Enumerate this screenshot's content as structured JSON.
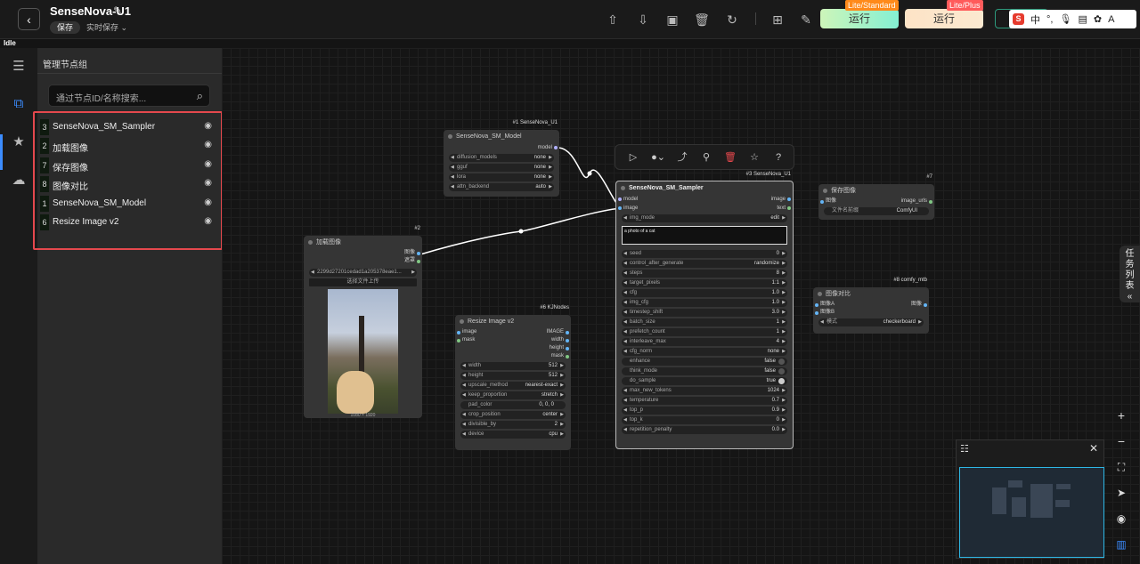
{
  "header": {
    "title": "SenseNova-U1",
    "save_label": "保存",
    "autosave_label": "实时保存",
    "run_lite_label": "运行",
    "run_lite_tag": "Lite/Standard",
    "run_plus_label": "运行",
    "run_plus_tag": "Lite/Plus",
    "ime_items": [
      "中",
      "A"
    ]
  },
  "status": "Idle",
  "panel": {
    "title": "管理节点组",
    "search_placeholder": "通过节点ID/名称搜索...",
    "nodes": [
      {
        "id": "3",
        "name": "SenseNova_SM_Sampler"
      },
      {
        "id": "2",
        "name": "加载图像"
      },
      {
        "id": "7",
        "name": "保存图像"
      },
      {
        "id": "8",
        "name": "图像对比"
      },
      {
        "id": "1",
        "name": "SenseNova_SM_Model"
      },
      {
        "id": "6",
        "name": "Resize Image v2"
      }
    ]
  },
  "canvas": {
    "model_node": {
      "badge": "#1 SenseNova_U1",
      "title": "SenseNova_SM_Model",
      "output": "model",
      "widgets": [
        {
          "k": "diffusion_models",
          "v": "none"
        },
        {
          "k": "gguf",
          "v": "none"
        },
        {
          "k": "lora",
          "v": "none"
        },
        {
          "k": "attn_backend",
          "v": "auto"
        }
      ]
    },
    "load_node": {
      "badge": "#2",
      "title": "加载图像",
      "out1": "图像",
      "out2": "遮罩",
      "file": "2299d27201cedad1a205378eae1...",
      "upload": "选择文件上传",
      "dims": "1080 × 1920"
    },
    "resize_node": {
      "badge": "#6 KJNodes",
      "title": "Resize Image v2",
      "in1": "image",
      "in2": "mask",
      "outs": [
        "IMAGE",
        "width",
        "height",
        "mask"
      ],
      "widgets": [
        {
          "k": "width",
          "v": "512"
        },
        {
          "k": "height",
          "v": "512"
        },
        {
          "k": "upscale_method",
          "v": "nearest-exact"
        },
        {
          "k": "keep_proportion",
          "v": "stretch"
        },
        {
          "k": "pad_color",
          "v": "0, 0, 0"
        },
        {
          "k": "crop_position",
          "v": "center"
        },
        {
          "k": "divisible_by",
          "v": "2"
        },
        {
          "k": "device",
          "v": "cpu"
        }
      ]
    },
    "sampler_node": {
      "badge": "#3 SenseNova_U1",
      "title": "SenseNova_SM_Sampler",
      "in1": "model",
      "in2": "image",
      "out1": "image",
      "out2": "text",
      "img_mode": {
        "k": "img_mode",
        "v": "edit"
      },
      "prompt": "a photo of a cat",
      "widgets": [
        {
          "k": "seed",
          "v": "0"
        },
        {
          "k": "control_after_generate",
          "v": "randomize"
        },
        {
          "k": "steps",
          "v": "8"
        },
        {
          "k": "target_pixels",
          "v": "1:1"
        },
        {
          "k": "cfg",
          "v": "1.0"
        },
        {
          "k": "img_cfg",
          "v": "1.0"
        },
        {
          "k": "timestep_shift",
          "v": "3.0"
        },
        {
          "k": "batch_size",
          "v": "1"
        },
        {
          "k": "prefetch_count",
          "v": "1"
        },
        {
          "k": "interleave_max",
          "v": "4"
        },
        {
          "k": "cfg_norm",
          "v": "none"
        }
      ],
      "toggles": [
        {
          "k": "enhance",
          "v": "false"
        },
        {
          "k": "think_mode",
          "v": "false"
        },
        {
          "k": "do_sample",
          "v": "true"
        }
      ],
      "widgets2": [
        {
          "k": "max_new_tokens",
          "v": "1024"
        },
        {
          "k": "temperature",
          "v": "0.7"
        },
        {
          "k": "top_p",
          "v": "0.9"
        },
        {
          "k": "top_k",
          "v": "0"
        },
        {
          "k": "repetition_penalty",
          "v": "0.0"
        }
      ]
    },
    "save_node": {
      "badge": "#7",
      "title": "保存图像",
      "in1": "图像",
      "out1": "image_urls",
      "widget": {
        "k": "文件名前缀",
        "v": "ComfyUI"
      }
    },
    "compare_node": {
      "badge": "#8 comfy_mtb",
      "title": "图像对比",
      "in1": "图像A",
      "in2": "图像B",
      "out1": "图像",
      "widget": {
        "k": "模式",
        "v": "checkerboard"
      }
    }
  },
  "task_tab": "任务列表"
}
